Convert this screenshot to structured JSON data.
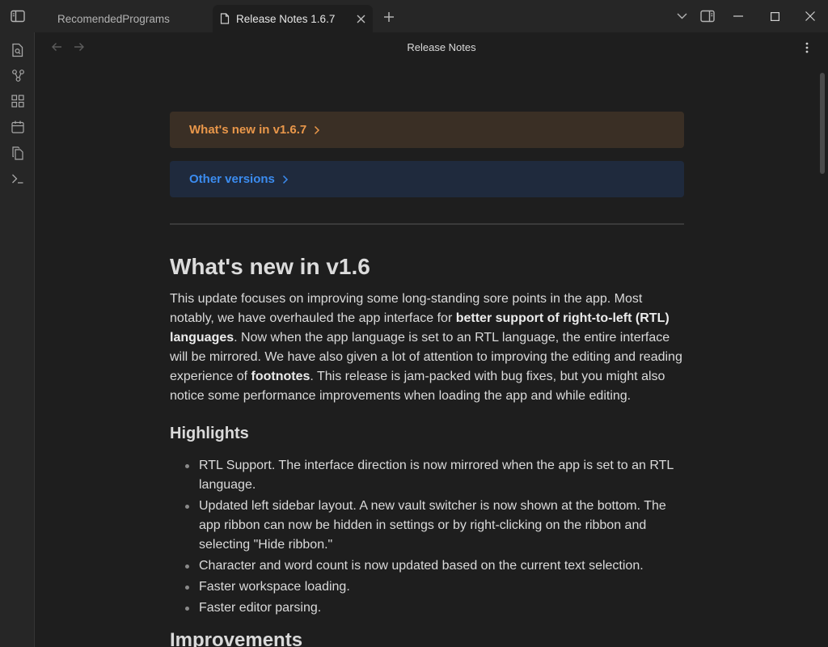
{
  "window": {
    "tabs": [
      {
        "label": "RecomendedPrograms",
        "active": false
      },
      {
        "label": "Release Notes 1.6.7",
        "active": true
      }
    ]
  },
  "view": {
    "title": "Release Notes"
  },
  "callouts": {
    "whats_new": "What's new in v1.6.7",
    "other_versions": "Other versions"
  },
  "article": {
    "h1": "What's new in v1.6",
    "intro": {
      "t1": "This update focuses on improving some long-standing sore points in the app. Most notably, we have overhauled the app interface for ",
      "b1": "better support of right-to-left (RTL) languages",
      "t2": ". Now when the app language is set to an RTL language, the entire interface will be mirrored. We have also given a lot of attention to improving the editing and reading experience of ",
      "b2": "footnotes",
      "t3": ". This release is jam-packed with bug fixes, but you might also notice some performance improvements when loading the app and while editing."
    },
    "highlights_heading": "Highlights",
    "highlights": [
      "RTL Support. The interface direction is now mirrored when the app is set to an RTL language.",
      "Updated left sidebar layout. A new vault switcher is now shown at the bottom. The app ribbon can now be hidden in settings or by right-clicking on the ribbon and selecting \"Hide ribbon.\"",
      "Character and word count is now updated based on the current text selection.",
      "Faster workspace loading.",
      "Faster editor parsing."
    ],
    "next_heading": "Improvements"
  },
  "colors": {
    "accent_orange": "#e9974a",
    "accent_blue": "#3b8cf0",
    "background": "#1e1e1e",
    "chrome": "#262626"
  },
  "icons": [
    "sidebar-toggle-icon",
    "file-icon",
    "close-icon",
    "plus-icon",
    "chevron-down-icon",
    "split-view-icon",
    "minimize-icon",
    "maximize-icon",
    "window-close-icon",
    "open-file-icon",
    "graph-icon",
    "canvas-icon",
    "calendar-icon",
    "copy-icon",
    "terminal-icon",
    "arrow-left-icon",
    "arrow-right-icon",
    "more-options-icon",
    "chevron-right-icon"
  ]
}
